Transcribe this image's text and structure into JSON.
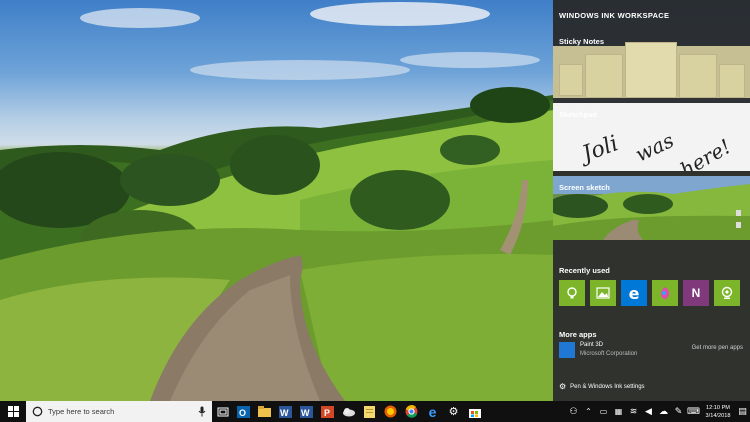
{
  "panel": {
    "title": "WINDOWS INK WORKSPACE",
    "sticky_notes_label": "Sticky Notes",
    "sketchpad_label": "Sketchpad",
    "sketchpad_handwriting": "Joli was here!",
    "screen_sketch_label": "Screen sketch",
    "recently_used_label": "Recently used",
    "recently_used_apps": [
      "Tips",
      "Photos",
      "Microsoft Edge",
      "Paint 3D",
      "OneNote",
      "Webcam app"
    ],
    "more_apps_label": "More apps",
    "more_apps": [
      {
        "name": "Paint 3D",
        "publisher": "Microsoft Corporation"
      }
    ],
    "get_more_label": "Get more pen apps",
    "settings_label": "Pen & Windows Ink settings"
  },
  "taskbar": {
    "search_placeholder": "Type here to search",
    "pinned_icons": [
      "task-view-icon",
      "outlook-icon",
      "file-explorer-icon",
      "word-icon",
      "word-icon",
      "powerpoint-icon",
      "cloud-app-icon",
      "notes-icon",
      "firefox-icon",
      "chrome-icon",
      "edge-icon",
      "settings-gear-icon",
      "store-icon"
    ],
    "time": "12:10 PM",
    "date": "3/14/2018"
  },
  "colors": {
    "accent_green": "#7cb52a",
    "edge_blue": "#0078d7",
    "onenote_purple": "#80397b",
    "panel_bg": "#282828",
    "taskbar_bg": "#101010"
  }
}
